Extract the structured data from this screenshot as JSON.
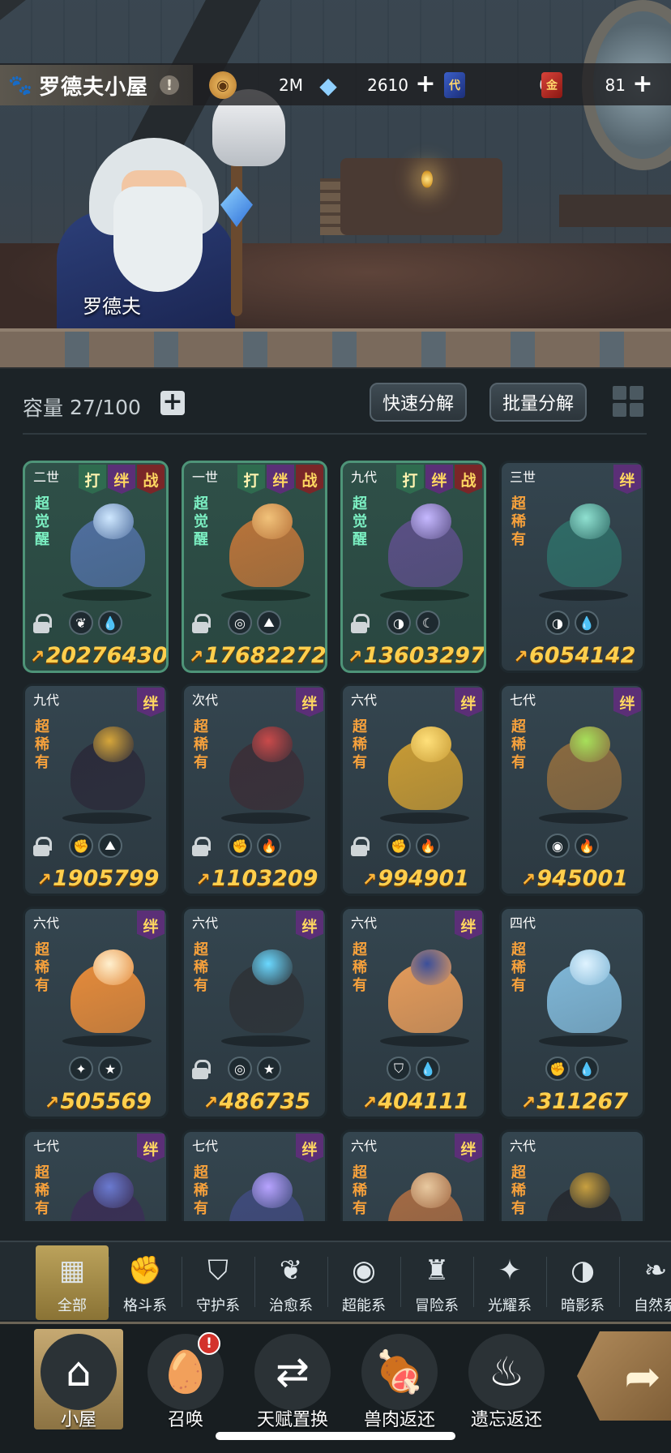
{
  "header": {
    "title": "罗德夫小屋",
    "npc_name": "罗德夫",
    "resources": [
      {
        "icon": "gold-coin-icon",
        "value": "2M",
        "has_plus": false
      },
      {
        "icon": "blue-crystal-icon",
        "value": "2610",
        "has_plus": true
      },
      {
        "icon": "blue-card-icon",
        "glyph": "代",
        "value": "0",
        "has_plus": false
      },
      {
        "icon": "red-card-icon",
        "glyph": "金",
        "value": "81",
        "has_plus": true
      }
    ]
  },
  "toolbar": {
    "capacity_label": "容量",
    "capacity_value": "27/100",
    "quick_decompose": "快速分解",
    "batch_decompose": "批量分解"
  },
  "pets": [
    {
      "gen": "二世",
      "tags": [
        "打",
        "绊",
        "战"
      ],
      "rarity": "超觉醒",
      "awake": true,
      "locked": true,
      "elements": [
        "leaf-icon",
        "water-icon"
      ],
      "power": "20276430",
      "color": "#4f6e9e",
      "accent": "#cfe8ff"
    },
    {
      "gen": "一世",
      "tags": [
        "打",
        "绊",
        "战"
      ],
      "rarity": "超觉醒",
      "awake": true,
      "locked": true,
      "elements": [
        "shield-element-icon",
        "rock-icon"
      ],
      "power": "17682272",
      "color": "#b8733a",
      "accent": "#f1c27a"
    },
    {
      "gen": "九代",
      "tags": [
        "打",
        "绊",
        "战"
      ],
      "rarity": "超觉醒",
      "awake": true,
      "locked": true,
      "elements": [
        "shadow-icon",
        "moon-icon"
      ],
      "power": "13603297",
      "color": "#5a4f85",
      "accent": "#c5b8ff"
    },
    {
      "gen": "三世",
      "tags": [
        "绊"
      ],
      "rarity": "超稀有",
      "awake": false,
      "locked": false,
      "elements": [
        "shadow-icon",
        "water-icon"
      ],
      "power": "6054142",
      "color": "#2f6b66",
      "accent": "#8fe0d0"
    },
    {
      "gen": "九代",
      "tags": [
        "绊"
      ],
      "rarity": "超稀有",
      "awake": false,
      "locked": true,
      "elements": [
        "fist-icon",
        "rock-icon"
      ],
      "power": "1905799",
      "color": "#2b2b3a",
      "accent": "#d6a63a"
    },
    {
      "gen": "次代",
      "tags": [
        "绊"
      ],
      "rarity": "超稀有",
      "awake": false,
      "locked": true,
      "elements": [
        "fist-icon",
        "fire-icon"
      ],
      "power": "1103209",
      "color": "#3a2f38",
      "accent": "#c94a4a"
    },
    {
      "gen": "六代",
      "tags": [
        "绊"
      ],
      "rarity": "超稀有",
      "awake": false,
      "locked": true,
      "elements": [
        "fist-icon",
        "fire-icon"
      ],
      "power": "994901",
      "color": "#c79a34",
      "accent": "#ffe07a"
    },
    {
      "gen": "七代",
      "tags": [
        "绊"
      ],
      "rarity": "超稀有",
      "awake": false,
      "locked": false,
      "elements": [
        "alien-icon",
        "fire-icon"
      ],
      "power": "945001",
      "color": "#8a6a40",
      "accent": "#a6e05a"
    },
    {
      "gen": "六代",
      "tags": [
        "绊"
      ],
      "rarity": "超稀有",
      "awake": false,
      "locked": false,
      "elements": [
        "light-icon",
        "star-icon"
      ],
      "power": "505569",
      "color": "#e48a3a",
      "accent": "#fff0cf"
    },
    {
      "gen": "六代",
      "tags": [
        "绊"
      ],
      "rarity": "超稀有",
      "awake": false,
      "locked": true,
      "elements": [
        "shield-element-icon",
        "star-icon"
      ],
      "power": "486735",
      "color": "#2e3338",
      "accent": "#6ad8ff"
    },
    {
      "gen": "六代",
      "tags": [
        "绊"
      ],
      "rarity": "超稀有",
      "awake": false,
      "locked": false,
      "elements": [
        "guard-icon",
        "water-icon"
      ],
      "power": "404111",
      "color": "#e39a5a",
      "accent": "#3b4f9a"
    },
    {
      "gen": "四代",
      "tags": [],
      "rarity": "超稀有",
      "awake": false,
      "locked": false,
      "elements": [
        "fist-icon",
        "water-icon"
      ],
      "power": "311267",
      "color": "#7fb6d6",
      "accent": "#dff3ff"
    },
    {
      "gen": "七代",
      "tags": [
        "绊"
      ],
      "rarity": "超稀有",
      "awake": false,
      "locked": false,
      "elements": [],
      "power": "",
      "color": "#3a2f55",
      "accent": "#6a7ad0"
    },
    {
      "gen": "七代",
      "tags": [
        "绊"
      ],
      "rarity": "超稀有",
      "awake": false,
      "locked": false,
      "elements": [],
      "power": "",
      "color": "#3f4a7a",
      "accent": "#b7a3ff"
    },
    {
      "gen": "六代",
      "tags": [
        "绊"
      ],
      "rarity": "超稀有",
      "awake": false,
      "locked": false,
      "elements": [],
      "power": "",
      "color": "#a36a44",
      "accent": "#e8c9a0"
    },
    {
      "gen": "六代",
      "tags": [],
      "rarity": "超稀有",
      "awake": false,
      "locked": false,
      "elements": [],
      "power": "",
      "color": "#262a30",
      "accent": "#c8a040"
    }
  ],
  "categories": [
    {
      "label": "全部",
      "icon": "all-blocks-icon",
      "glyph": "▦",
      "active": true
    },
    {
      "label": "格斗系",
      "icon": "fist-icon",
      "glyph": "✊",
      "active": false
    },
    {
      "label": "守护系",
      "icon": "shield-icon",
      "glyph": "⛉",
      "active": false
    },
    {
      "label": "治愈系",
      "icon": "sprout-icon",
      "glyph": "❦",
      "active": false
    },
    {
      "label": "超能系",
      "icon": "alien-icon",
      "glyph": "◉",
      "active": false
    },
    {
      "label": "冒险系",
      "icon": "lantern-icon",
      "glyph": "♜",
      "active": false
    },
    {
      "label": "光耀系",
      "icon": "sparkle-icon",
      "glyph": "✦",
      "active": false
    },
    {
      "label": "暗影系",
      "icon": "shadow-eye-icon",
      "glyph": "◑",
      "active": false
    },
    {
      "label": "自然系",
      "icon": "leaf-icon",
      "glyph": "❧",
      "active": false
    }
  ],
  "bottom_nav": [
    {
      "label": "小屋",
      "icon": "house-icon",
      "glyph": "⌂",
      "active": true,
      "badge": ""
    },
    {
      "label": "召唤",
      "icon": "egg-icon",
      "glyph": "🥚",
      "active": false,
      "badge": "!"
    },
    {
      "label": "天赋置换",
      "icon": "swap-icon",
      "glyph": "⇄",
      "active": false,
      "badge": ""
    },
    {
      "label": "兽肉返还",
      "icon": "meat-icon",
      "glyph": "🍖",
      "active": false,
      "badge": ""
    },
    {
      "label": "遗忘返还",
      "icon": "flame-icon",
      "glyph": "♨",
      "active": false,
      "badge": ""
    }
  ]
}
